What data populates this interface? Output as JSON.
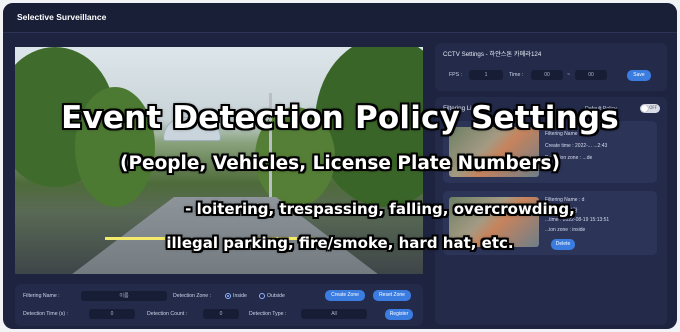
{
  "window": {
    "title": "Selective Surveillance"
  },
  "cctv": {
    "title": "CCTV Settings - 하얀스톤 카메라124",
    "fps_label": "FPS :",
    "fps_value": "1",
    "time_label": "Time :",
    "time_from": "00",
    "time_sep": "~",
    "time_to": "00",
    "save_label": "Save"
  },
  "filtering": {
    "title": "Filtering List",
    "default_policy_label": "Default Policy",
    "toggle_label": "OFF",
    "cards": [
      {
        "lines": [
          "Filtering Name : ",
          "Create time : 2022-...  ...2:43",
          "Detection zone : ...de"
        ]
      },
      {
        "lines": [
          "Filtering Name : d",
          "...n Type : 사람",
          "...time : 2022-08-19 15:13:51",
          "...ion zone : inside"
        ],
        "delete_label": "Delete"
      }
    ]
  },
  "controls": {
    "filtering_name_label": "Filtering Name :",
    "filtering_name_placeholder": "이름",
    "detection_zone_label": "Detection Zone :",
    "inside_label": "Inside",
    "outside_label": "Outside",
    "create_zone_label": "Create Zone",
    "reset_zone_label": "Reset Zone",
    "detection_time_label": "Detection Time (s) :",
    "detection_time_value": "0",
    "detection_count_label": "Detection Count :",
    "detection_count_value": "0",
    "detection_type_label": "Detection Type :",
    "detection_type_value": "All",
    "register_label": "Register"
  },
  "overlay": {
    "line1": "Event Detection Policy Settings",
    "line2": "(People, Vehicles, License Plate Numbers)",
    "line3": "- loitering, trespassing, falling, overcrowding,",
    "line4": "illegal parking, fire/smoke, hard hat, etc."
  },
  "colors": {
    "accent": "#3b7ce0",
    "window_bg": "#1e2440",
    "panel_bg": "#232a4a"
  }
}
